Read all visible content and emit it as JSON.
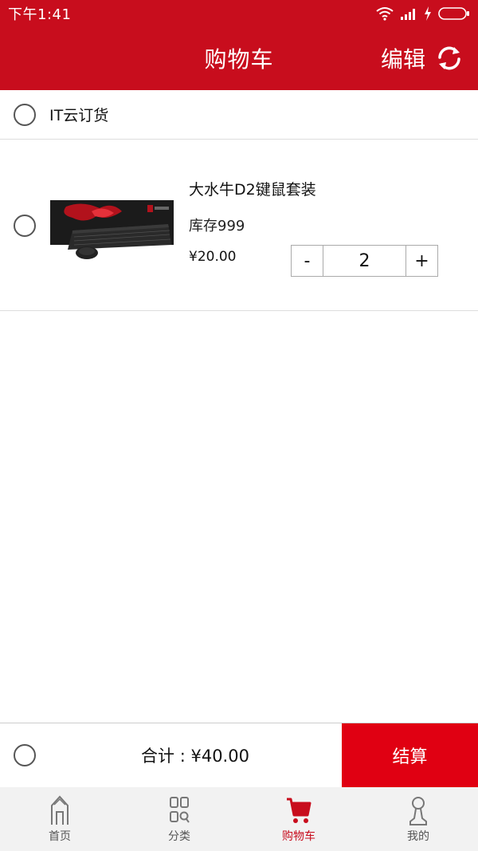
{
  "status_bar": {
    "time": "下午1:41",
    "icons": [
      "wifi-icon",
      "signal-icon",
      "charging-icon",
      "battery-icon"
    ]
  },
  "header": {
    "title": "购物车",
    "edit_label": "编辑",
    "refresh_icon": "refresh-icon"
  },
  "store": {
    "name": "IT云订货"
  },
  "cart_items": [
    {
      "name": "大水牛D2键鼠套装",
      "stock": "库存999",
      "price": "¥20.00",
      "quantity": "2",
      "minus_label": "-",
      "plus_label": "+",
      "image": "keyboard-mouse-product-image"
    }
  ],
  "summary": {
    "total": "合计 : ¥40.00",
    "checkout_label": "结算"
  },
  "bottom_nav": {
    "items": [
      {
        "label": "首页",
        "icon": "home-icon",
        "active": false
      },
      {
        "label": "分类",
        "icon": "category-icon",
        "active": false
      },
      {
        "label": "购物车",
        "icon": "cart-icon",
        "active": true
      },
      {
        "label": "我的",
        "icon": "profile-icon",
        "active": false
      }
    ]
  },
  "colors": {
    "brand_red": "#c80d1d",
    "checkout_red": "#e00012",
    "nav_background": "#f2f2f2",
    "divider": "#dddddd"
  }
}
